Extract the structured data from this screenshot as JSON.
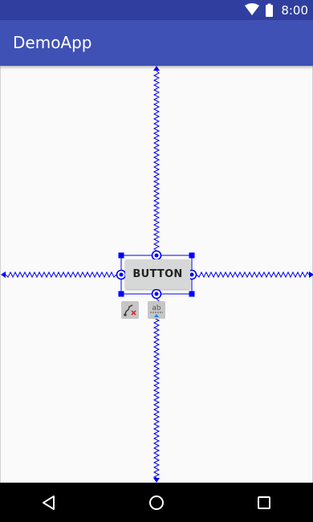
{
  "status_bar": {
    "time": "8:00",
    "icons": [
      "wifi-icon",
      "battery-icon"
    ]
  },
  "app_bar": {
    "title": "DemoApp",
    "color": "#3f51b5"
  },
  "canvas": {
    "button": {
      "label": "BUTTON"
    },
    "constraint_color": "#0000ff",
    "tools": [
      "clear-constraints-icon",
      "baseline-icon"
    ]
  },
  "nav_bar": {
    "buttons": [
      "back-icon",
      "home-icon",
      "recents-icon"
    ]
  }
}
